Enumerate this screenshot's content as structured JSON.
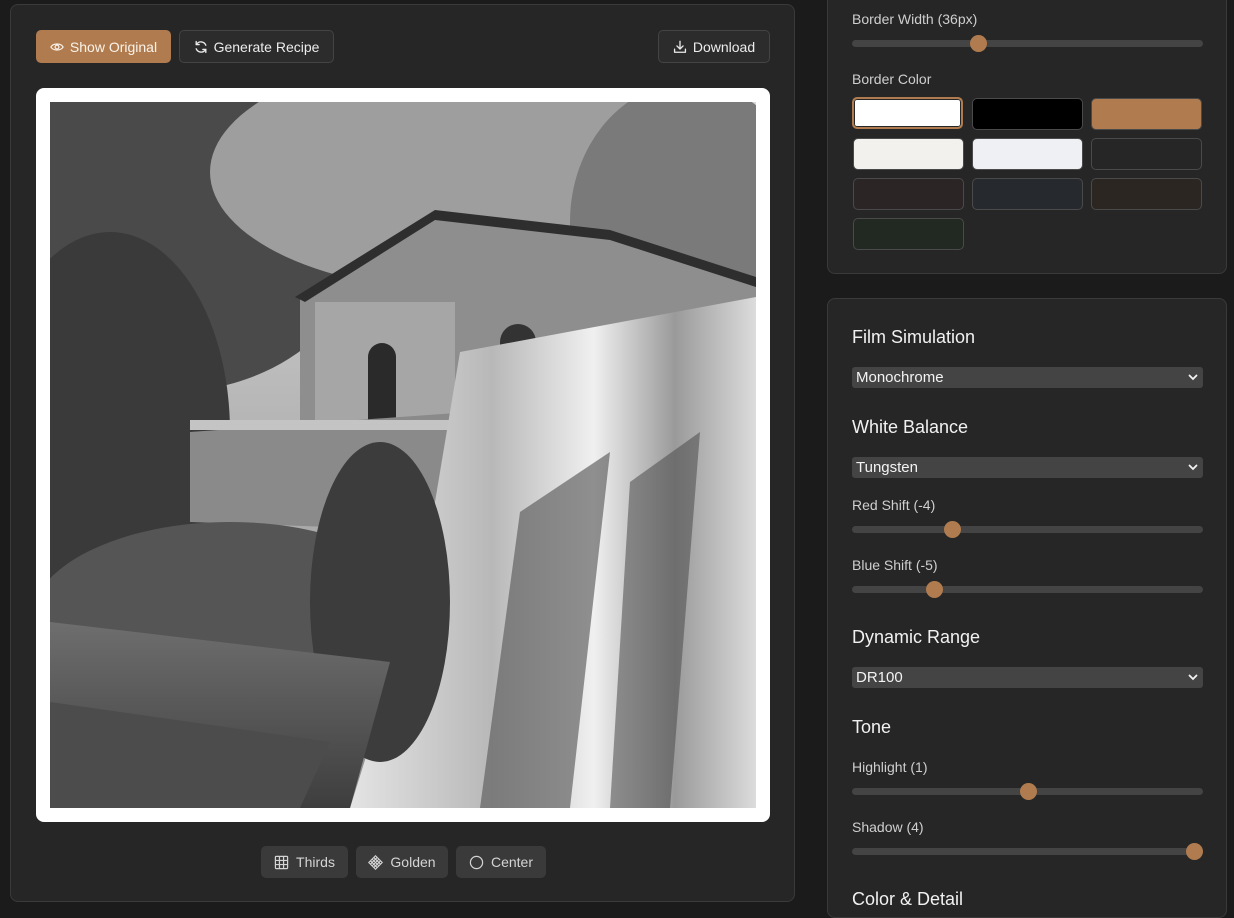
{
  "toolbar": {
    "show_original_label": "Show Original",
    "generate_recipe_label": "Generate Recipe",
    "download_label": "Download"
  },
  "overlay_buttons": {
    "thirds_label": "Thirds",
    "golden_label": "Golden",
    "center_label": "Center"
  },
  "border": {
    "width_label": "Border Width (36px)",
    "width_value": 36,
    "color_label": "Border Color",
    "swatches": [
      "#ffffff",
      "#000000",
      "#b07c4f",
      "#f2f1ed",
      "#eef0f4",
      "#262626",
      "#2b2625",
      "#262a2e",
      "#2b2622",
      "#222822"
    ],
    "selected_swatch": "#ffffff"
  },
  "film_simulation": {
    "heading": "Film Simulation",
    "selected": "Monochrome"
  },
  "white_balance": {
    "heading": "White Balance",
    "selected": "Tungsten",
    "red_shift_label": "Red Shift (-4)",
    "red_shift_value": -4,
    "blue_shift_label": "Blue Shift (-5)",
    "blue_shift_value": -5
  },
  "dynamic_range": {
    "heading": "Dynamic Range",
    "selected": "DR100"
  },
  "tone": {
    "heading": "Tone",
    "highlight_label": "Highlight (1)",
    "highlight_value": 1,
    "shadow_label": "Shadow (4)",
    "shadow_value": 4
  },
  "color_detail": {
    "heading": "Color & Detail"
  },
  "colors": {
    "accent": "#b07c4f",
    "panel": "#262626",
    "background": "#1b1b1b"
  }
}
